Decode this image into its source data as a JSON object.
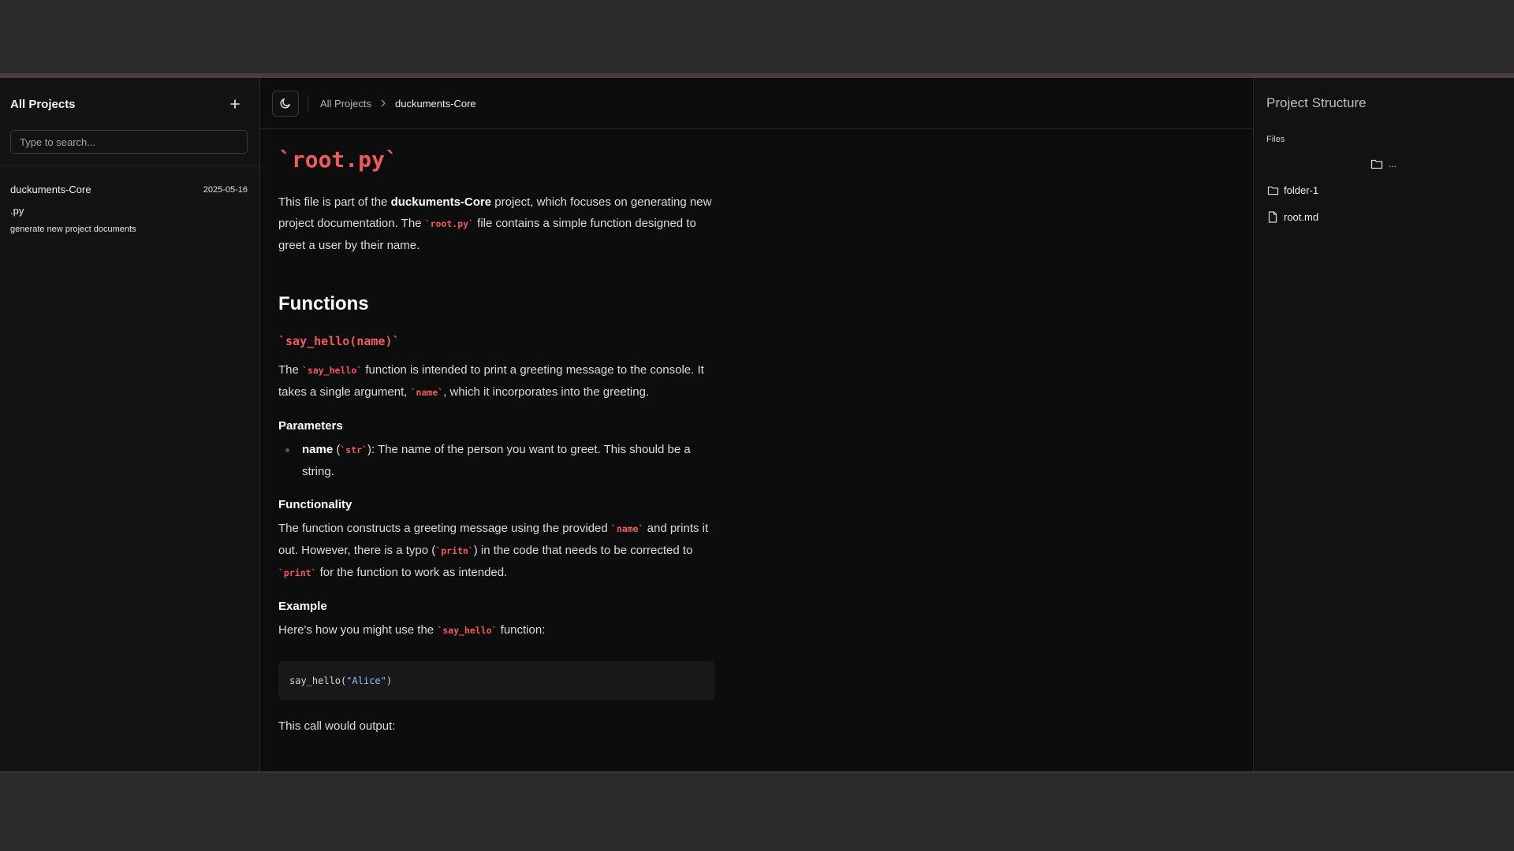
{
  "sidebar": {
    "title": "All Projects",
    "add_icon": "plus-icon",
    "search_placeholder": "Type to search...",
    "search_value": "",
    "projects": [
      {
        "name": "duckuments-Core",
        "date": "2025-05-16",
        "ext": ".py",
        "description": "generate new project documents"
      }
    ]
  },
  "header": {
    "theme_icon": "moon-icon",
    "breadcrumb_root": "All Projects",
    "breadcrumb_sep_icon": "chevron-right-icon",
    "breadcrumb_current": "duckuments-Core"
  },
  "doc": {
    "title": "`root.py`",
    "intro": {
      "t1": "This file is part of the ",
      "bold1": "duckuments-Core",
      "t2": " project, which focuses on generating new project documentation. The ",
      "code1": "`root.py`",
      "t3": " file contains a simple function designed to greet a user by their name."
    },
    "functions_heading": "Functions",
    "fn_heading": "`say_hello(name)`",
    "fn_desc": {
      "t1": "The ",
      "code1": "`say_hello`",
      "t2": " function is intended to print a greeting message to the console. It takes a single argument, ",
      "code2": "`name`",
      "t3": ", which it incorporates into the greeting."
    },
    "params_heading": "Parameters",
    "param": {
      "name": "name",
      "open": " (",
      "type": "`str`",
      "desc": "): The name of the person you want to greet. This should be a string."
    },
    "functionality_heading": "Functionality",
    "functionality": {
      "t1": "The function constructs a greeting message using the provided ",
      "code1": "`name`",
      "t2": " and prints it out. However, there is a typo (",
      "code2": "`pritn`",
      "t3": ") in the code that needs to be corrected to ",
      "code3": "`print`",
      "t4": " for the function to work as intended."
    },
    "example_heading": "Example",
    "example": {
      "t1": "Here's how you might use the ",
      "code1": "`say_hello`",
      "t2": " function:"
    },
    "code_block": {
      "fn": "say_hello(",
      "arg": "\"Alice\"",
      "close": ")"
    },
    "output_text": "This call would output:"
  },
  "right_panel": {
    "title": "Project Structure",
    "files_label": "Files",
    "toolbar_icon": "folder-icon",
    "toolbar_more": "...",
    "tree": [
      {
        "type": "folder",
        "icon": "folder-icon",
        "name": "folder-1"
      },
      {
        "type": "file",
        "icon": "file-icon",
        "name": "root.md"
      }
    ]
  },
  "colors": {
    "accent_code": "#f05a5a",
    "background": "#0d0d0e",
    "string": "#89c2ff"
  }
}
